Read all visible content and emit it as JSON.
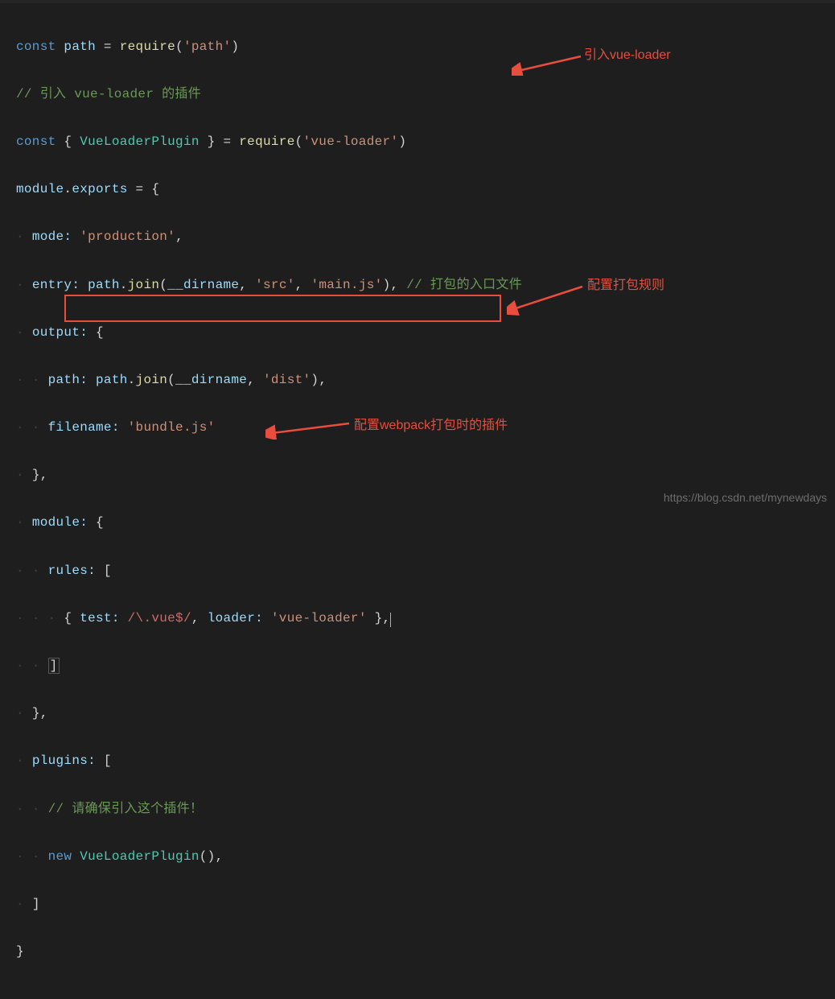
{
  "code": {
    "l1_const": "const",
    "l1_path": "path",
    "l1_eq": " = ",
    "l1_require": "require",
    "l1_open": "(",
    "l1_str": "'path'",
    "l1_close": ")",
    "l2_cmt": "// 引入 vue-loader 的插件",
    "l3_const": "const",
    "l3_open": " { ",
    "l3_cls": "VueLoaderPlugin",
    "l3_close": " } = ",
    "l3_require": "require",
    "l3_popen": "(",
    "l3_str": "'vue-loader'",
    "l3_pclose": ")",
    "l4_module": "module",
    "l4_dot": ".",
    "l4_exports": "exports",
    "l4_eq": " = {",
    "l5_mode": "mode:",
    "l5_str": " 'production'",
    "l5_comma": ",",
    "l6_entry": "entry:",
    "l6_path": " path",
    "l6_dot": ".",
    "l6_join": "join",
    "l6_open": "(",
    "l6_dirname": "__dirname",
    "l6_c1": ", ",
    "l6_src": "'src'",
    "l6_c2": ", ",
    "l6_main": "'main.js'",
    "l6_close": "), ",
    "l6_cmt": "// 打包的入口文件",
    "l7_output": "output:",
    "l7_brace": " {",
    "l8_path": "path:",
    "l8_pathvar": " path",
    "l8_dot": ".",
    "l8_join": "join",
    "l8_open": "(",
    "l8_dirname": "__dirname",
    "l8_c": ", ",
    "l8_dist": "'dist'",
    "l8_close": "),",
    "l9_filename": "filename:",
    "l9_str": " 'bundle.js'",
    "l10_close": "},",
    "l11_module": "module:",
    "l11_brace": " {",
    "l12_rules": "rules:",
    "l12_bracket": " [",
    "l13_open": "{ ",
    "l13_test": "test:",
    "l13_regex": " /\\.vue$/",
    "l13_c": ", ",
    "l13_loader": "loader:",
    "l13_str": " 'vue-loader'",
    "l13_close": " },",
    "l14_bracket": "]",
    "l15_close": "},",
    "l16_plugins": "plugins:",
    "l16_bracket": " [",
    "l17_cmt": "// 请确保引入这个插件！",
    "l18_new": "new",
    "l18_cls": " VueLoaderPlugin",
    "l18_parens": "(),",
    "l19_bracket": "]",
    "l20_close": "}"
  },
  "annotations": {
    "a1": "引入vue-loader",
    "a2": "配置打包规则",
    "a3": "配置webpack打包时的插件"
  },
  "watermark": "https://blog.csdn.net/mynewdays"
}
